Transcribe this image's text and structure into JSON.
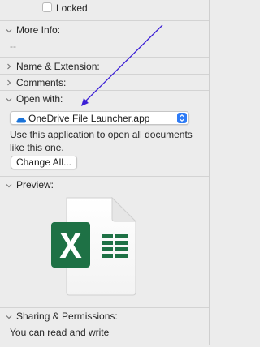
{
  "general": {
    "locked_label": "Locked",
    "locked_checked": false
  },
  "more_info": {
    "title": "More Info:",
    "value": "--"
  },
  "sections": {
    "name_extension": "Name & Extension:",
    "comments": "Comments:"
  },
  "open_with": {
    "title": "Open with:",
    "selected_app": "OneDrive File Launcher.app",
    "description": "Use this application to open all documents like this one.",
    "change_all_label": "Change All..."
  },
  "preview": {
    "title": "Preview:",
    "file_icon": "excel-document-icon"
  },
  "sharing": {
    "title": "Sharing & Permissions:",
    "summary": "You can read and write"
  },
  "colors": {
    "window_bg": "#ececec",
    "accent": "#2f7cf6",
    "annotation_arrow": "#3b1fd6",
    "excel_green": "#1e7145"
  }
}
